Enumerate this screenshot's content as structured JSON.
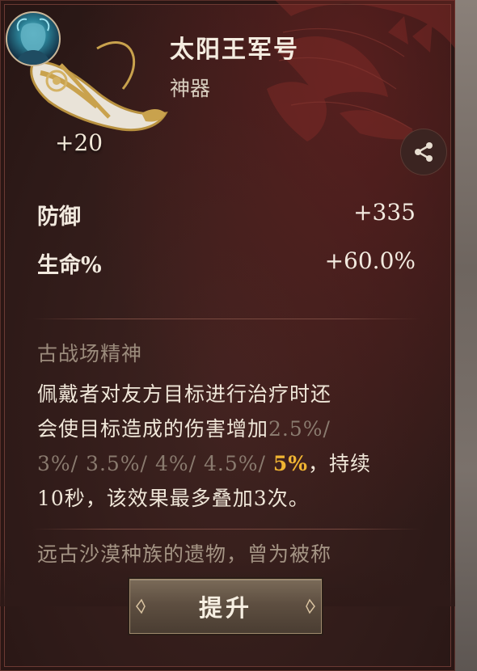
{
  "item": {
    "name": "太阳王军号",
    "type": "神器",
    "level": "+20"
  },
  "stats": [
    {
      "label": "防御",
      "value": "+335"
    },
    {
      "label": "生命%",
      "value": "+60.0%"
    }
  ],
  "skill": {
    "name": "古战场精神",
    "line1": "佩戴者对友方目标进行治疗时还",
    "line2_a": "会使目标造成的伤害增加",
    "tier1": "2.5%/",
    "tier2": "3%/",
    "tier3": "3.5%/",
    "tier4": "4%/",
    "tier5": "4.5%/",
    "tier6": "5%",
    "line3_tail": "，持续",
    "line4": "10秒，该效果最多叠加3次。"
  },
  "lore": "远古沙漠种族的遗物，曾为被称",
  "buttons": {
    "upgrade": "提升"
  },
  "icons": {
    "share": "share-icon",
    "portrait": "hero-portrait",
    "artifact": "horn-artifact-icon"
  },
  "colors": {
    "highlight": "#f0b432",
    "dim_tier": "#8a7b6f",
    "panel": "#2e1a18"
  }
}
